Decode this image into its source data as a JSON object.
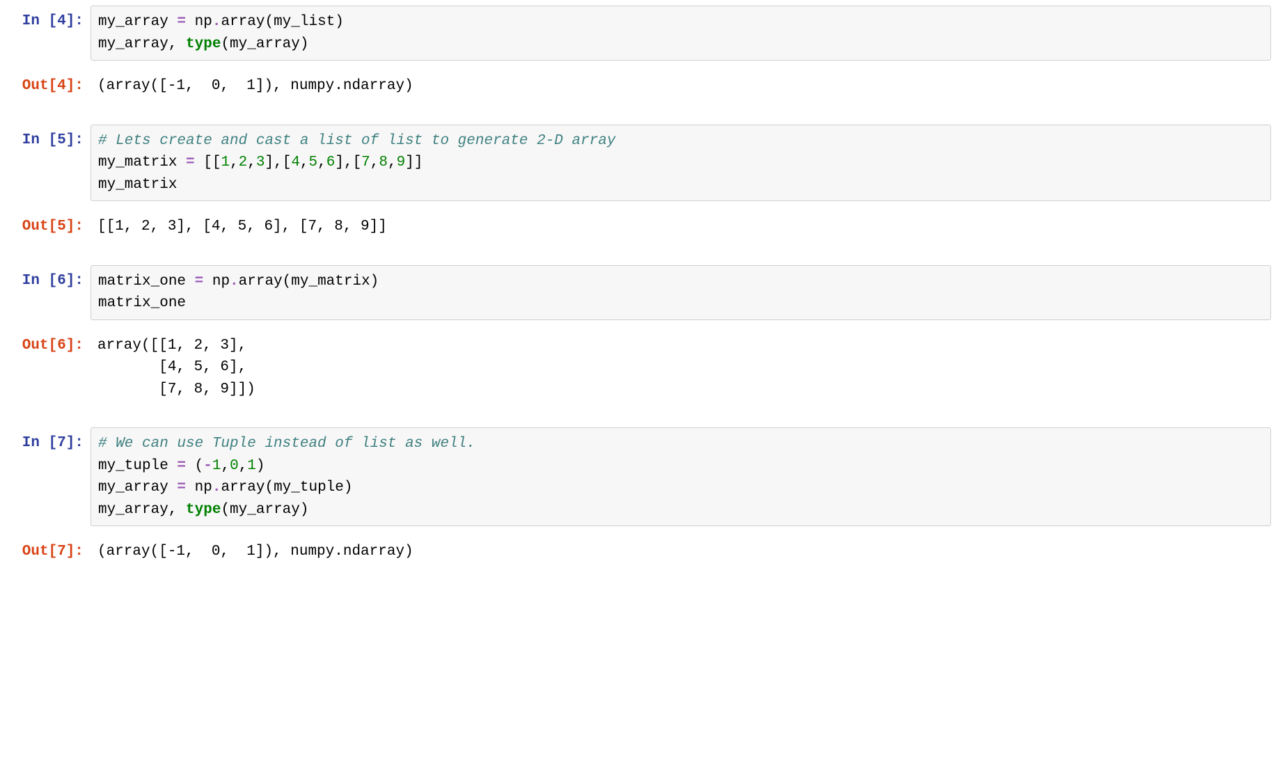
{
  "cells": [
    {
      "in_prompt": "In [4]:",
      "out_prompt": "Out[4]:",
      "code": {
        "l1_a": "my_array ",
        "l1_op": "=",
        "l1_b": " np",
        "l1_dot": ".",
        "l1_c": "array(my_list)",
        "l2_a": "my_array, ",
        "l2_type": "type",
        "l2_b": "(my_array)"
      },
      "output": "(array([-1,  0,  1]), numpy.ndarray)"
    },
    {
      "in_prompt": "In [5]:",
      "out_prompt": "Out[5]:",
      "code": {
        "l1_comment": "# Lets create and cast a list of list to generate 2-D array",
        "l2_a": "my_matrix ",
        "l2_op": "=",
        "l2_b": " [[",
        "l2_n1": "1",
        "l2_c1": ",",
        "l2_n2": "2",
        "l2_c2": ",",
        "l2_n3": "3",
        "l2_c3": "],[",
        "l2_n4": "4",
        "l2_c4": ",",
        "l2_n5": "5",
        "l2_c5": ",",
        "l2_n6": "6",
        "l2_c6": "],[",
        "l2_n7": "7",
        "l2_c7": ",",
        "l2_n8": "8",
        "l2_c8": ",",
        "l2_n9": "9",
        "l2_c9": "]]",
        "l3_a": "my_matrix"
      },
      "output": "[[1, 2, 3], [4, 5, 6], [7, 8, 9]]"
    },
    {
      "in_prompt": "In [6]:",
      "out_prompt": "Out[6]:",
      "code": {
        "l1_a": "matrix_one ",
        "l1_op": "=",
        "l1_b": " np",
        "l1_dot": ".",
        "l1_c": "array(my_matrix)",
        "l2_a": "matrix_one"
      },
      "output_l1": "array([[1, 2, 3],",
      "output_l2": "       [4, 5, 6],",
      "output_l3": "       [7, 8, 9]])"
    },
    {
      "in_prompt": "In [7]:",
      "out_prompt": "Out[7]:",
      "code": {
        "l1_comment": "# We can use Tuple instead of list as well.",
        "l2_a": "my_tuple ",
        "l2_op": "=",
        "l2_b": " (",
        "l2_neg": "-",
        "l2_n1": "1",
        "l2_c1": ",",
        "l2_n2": "0",
        "l2_c2": ",",
        "l2_n3": "1",
        "l2_c3": ")",
        "l3_a": "my_array ",
        "l3_op": "=",
        "l3_b": " np",
        "l3_dot": ".",
        "l3_c": "array(my_tuple)",
        "l4_a": "my_array, ",
        "l4_type": "type",
        "l4_b": "(my_array)"
      },
      "output": "(array([-1,  0,  1]), numpy.ndarray)"
    }
  ]
}
